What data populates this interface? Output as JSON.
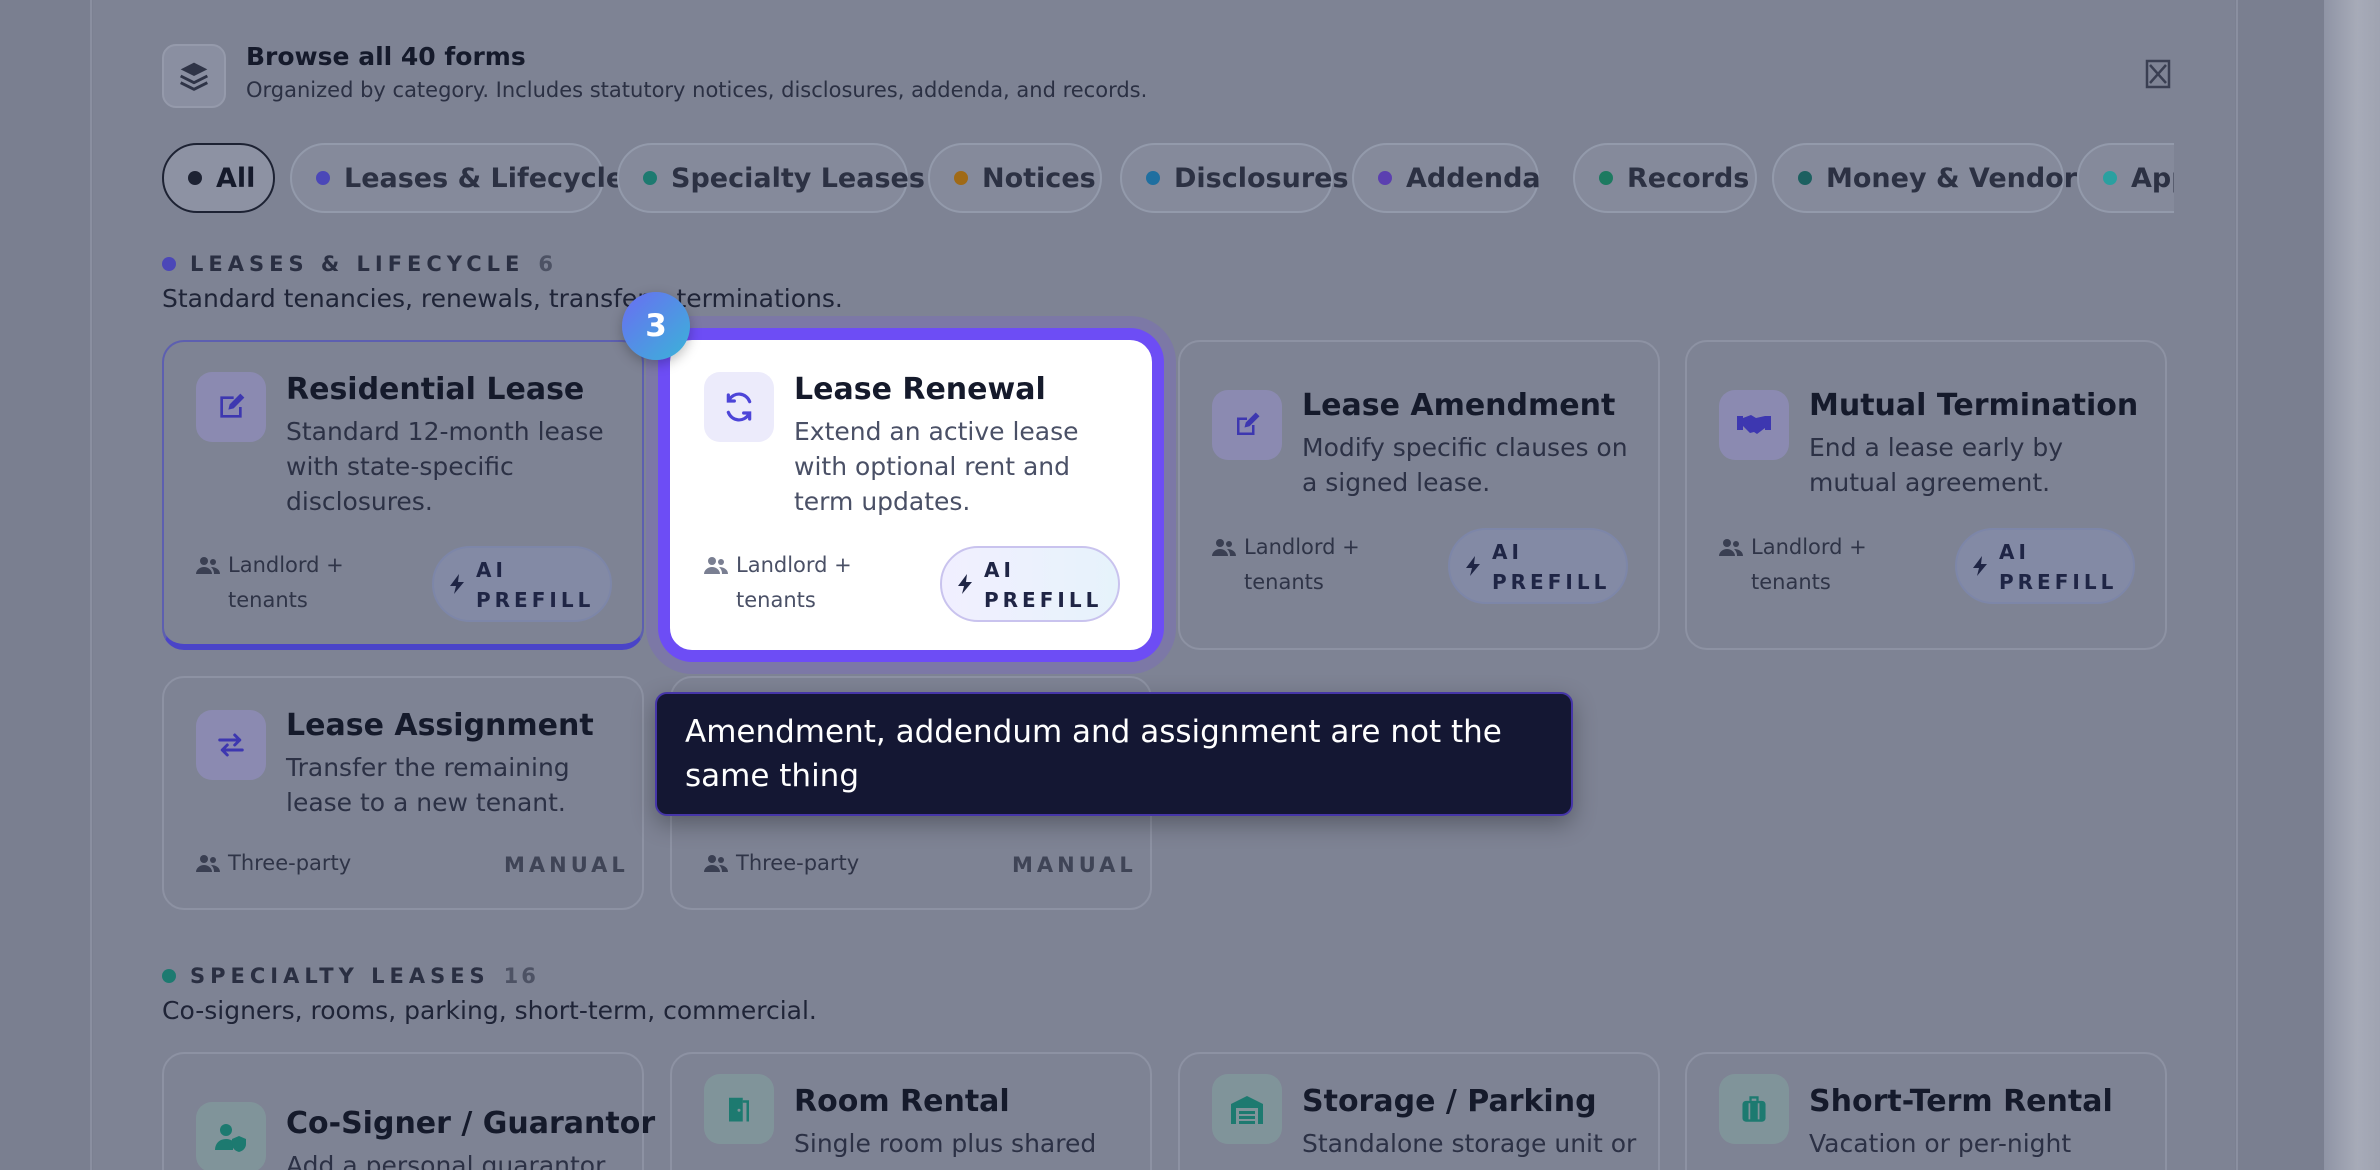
{
  "header": {
    "title": "Browse all 40 forms",
    "subtitle": "Organized by category. Includes statutory notices, disclosures, addenda, and records.",
    "icon": "layers-icon",
    "close_icon": "close-icon"
  },
  "filters": [
    {
      "label": "All",
      "color": "#1d2233",
      "active": true
    },
    {
      "label": "Leases & Lifecycle",
      "color": "#4b47b8"
    },
    {
      "label": "Specialty Leases",
      "color": "#1d7a70"
    },
    {
      "label": "Notices",
      "color": "#a06a16"
    },
    {
      "label": "Disclosures",
      "color": "#1f6fa0"
    },
    {
      "label": "Addenda",
      "color": "#5b3fb0"
    },
    {
      "label": "Records",
      "color": "#1d7a60"
    },
    {
      "label": "Money & Vendor",
      "color": "#1c6060"
    },
    {
      "label": "App",
      "color": "#2aa0a0"
    }
  ],
  "sections": [
    {
      "title": "LEASES & LIFECYCLE",
      "count": "6",
      "color": "#4b47b8",
      "description": "Standard tenancies, renewals, transfers, terminations."
    },
    {
      "title": "SPECIALTY LEASES",
      "count": "16",
      "color": "#1d7a70",
      "description": "Co-signers, rooms, parking, short-term, commercial."
    }
  ],
  "cards": [
    {
      "title": "Residential Lease",
      "desc": "Standard 12-month lease with state-specific disclosures.",
      "audience": "Landlord + tenants",
      "badge": "AI PREFILL",
      "icon": "signature-edit-icon"
    },
    {
      "title": "Lease Renewal",
      "desc": "Extend an active lease with optional rent and term updates.",
      "audience": "Landlord + tenants",
      "badge": "AI PREFILL",
      "icon": "refresh-icon"
    },
    {
      "title": "Lease Amendment",
      "desc": "Modify specific clauses on a signed lease.",
      "audience": "Landlord + tenants",
      "badge": "AI PREFILL",
      "icon": "pencil-square-icon"
    },
    {
      "title": "Mutual Termination",
      "desc": "End a lease early by mutual agreement.",
      "audience": "Landlord + tenants",
      "badge": "AI PREFILL",
      "icon": "handshake-icon"
    },
    {
      "title": "Lease Assignment",
      "desc": "Transfer the remaining lease to a new tenant.",
      "audience": "Three-party",
      "badge": "MANUAL",
      "icon": "swap-arrows-icon"
    },
    {
      "audience": "Three-party",
      "badge": "MANUAL"
    },
    {
      "title": "Co-Signer / Guarantor",
      "desc": "Add a personal guarantor",
      "icon": "user-shield-icon"
    },
    {
      "title": "Room Rental",
      "desc": "Single room plus shared",
      "icon": "door-open-icon"
    },
    {
      "title": "Storage / Parking",
      "desc": "Standalone storage unit or",
      "icon": "warehouse-icon"
    },
    {
      "title": "Short-Term Rental",
      "desc": "Vacation or per-night",
      "icon": "suitcase-icon"
    }
  ],
  "tour": {
    "step": "3",
    "tooltip": "Amendment, addendum and assignment are not the same thing"
  }
}
